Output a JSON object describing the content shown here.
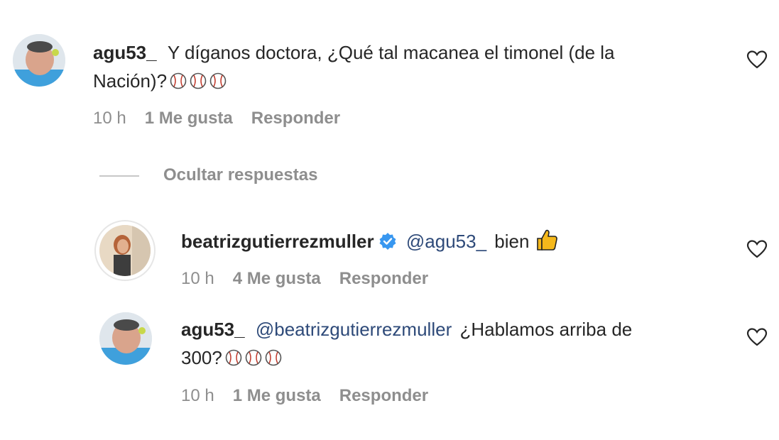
{
  "comments": [
    {
      "username": "agu53_",
      "text_line1": "Y díganos doctora, ¿Qué tal macanea el timonel (de la",
      "text_line2": "Nación)?",
      "emoji": [
        "baseball-icon",
        "baseball-icon",
        "baseball-icon"
      ],
      "time": "10 h",
      "likes": "1 Me gusta",
      "reply_label": "Responder"
    }
  ],
  "hide_replies_label": "Ocultar respuestas",
  "replies": [
    {
      "username": "beatrizgutierrezmuller",
      "verified": true,
      "mention": "@agu53_",
      "text": "bien",
      "emoji": "thumbs-up-icon",
      "time": "10 h",
      "likes": "4 Me gusta",
      "reply_label": "Responder"
    },
    {
      "username": "agu53_",
      "mention": "@beatrizgutierrezmuller",
      "text_line1": "¿Hablamos arriba de",
      "text_line2": "300?",
      "emoji": [
        "baseball-icon",
        "baseball-icon",
        "baseball-icon"
      ],
      "time": "10 h",
      "likes": "1 Me gusta",
      "reply_label": "Responder"
    }
  ],
  "colors": {
    "text": "#262626",
    "meta": "#8e8e8e",
    "mention": "#2e4a79",
    "verified": "#3897f0",
    "background": "#ffffff"
  }
}
